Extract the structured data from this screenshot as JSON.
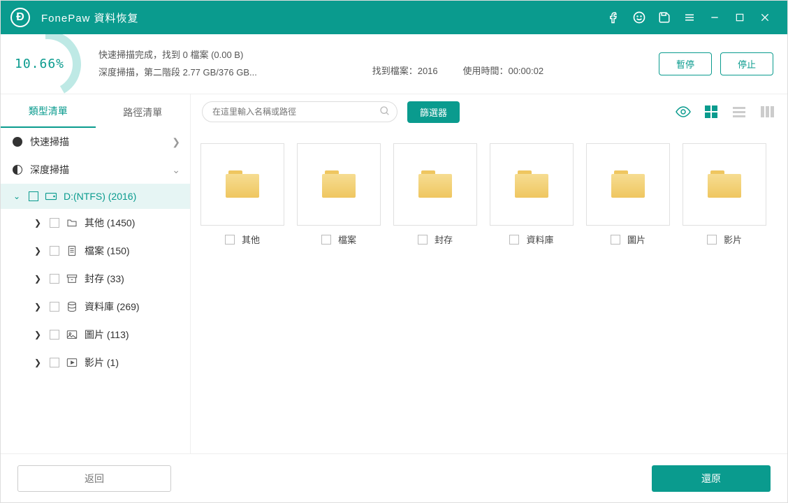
{
  "header": {
    "title": "FonePaw 資料恢复"
  },
  "status": {
    "percent": "10.66%",
    "line1": "快速掃描完成，找到 0 檔案 (0.00  B)",
    "line2": "深度掃描，第二階段 2.77 GB/376 GB...",
    "found_label": "找到檔案：2016",
    "time_label": "使用時間：00:00:02",
    "pause": "暫停",
    "stop": "停止"
  },
  "sidebar": {
    "tabs": {
      "type": "類型清單",
      "path": "路徑清單"
    },
    "quick_scan": "快速掃描",
    "deep_scan": "深度掃描",
    "drive": "D:(NTFS) (2016)",
    "items": [
      {
        "label": "其他 (1450)"
      },
      {
        "label": "檔案 (150)"
      },
      {
        "label": "封存 (33)"
      },
      {
        "label": "資料庫 (269)"
      },
      {
        "label": "圖片 (113)"
      },
      {
        "label": "影片 (1)"
      }
    ]
  },
  "toolbar": {
    "search_placeholder": "在這里輸入名稱或路徑",
    "filter": "篩選器"
  },
  "folders": [
    {
      "label": "其他"
    },
    {
      "label": "檔案"
    },
    {
      "label": "封存"
    },
    {
      "label": "資料庫"
    },
    {
      "label": "圖片"
    },
    {
      "label": "影片"
    }
  ],
  "footer": {
    "back": "返回",
    "recover": "還原"
  }
}
